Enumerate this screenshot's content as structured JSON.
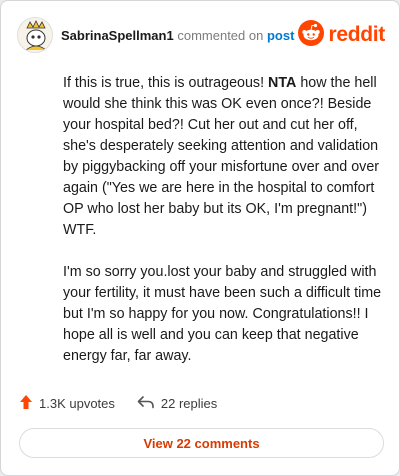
{
  "header": {
    "username": "SabrinaSpellman1",
    "commented_on": "commented on",
    "post_link": "post",
    "brand": "reddit"
  },
  "comment": {
    "p1_a": "If this is true, this is outrageous! ",
    "p1_bold": "NTA",
    "p1_b": " how the hell would she think this was OK even once?! Beside your hospital bed?! Cut her out and cut her off, she's desperately seeking attention and validation by piggybacking off your misfortune over and over again (\"Yes we are here in the hospital to comfort OP who lost her baby but its OK, I'm pregnant!\") WTF.",
    "p2": "I'm so sorry you.lost your baby and struggled with your fertility, it must have been such a difficult time but I'm so happy for you now. Congratulations!! I hope all is well and you can keep that negative energy far, far away."
  },
  "actions": {
    "upvotes": "1.3K upvotes",
    "replies": "22 replies"
  },
  "view_comments": "View 22 comments",
  "colors": {
    "accent": "#ff4500",
    "link": "#0079d3",
    "view_text": "#d93a00"
  },
  "icons": {
    "brand": "reddit-alien-icon",
    "upvote": "upvote-arrow-icon",
    "reply": "reply-arrow-icon"
  }
}
